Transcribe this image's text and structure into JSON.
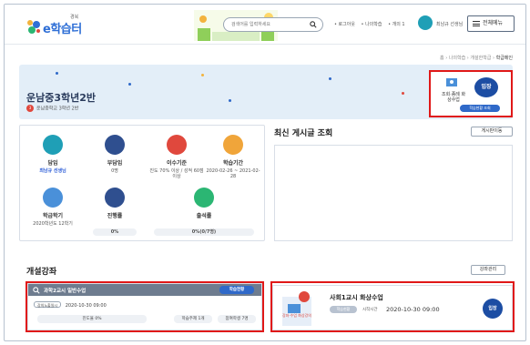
{
  "header": {
    "logo_sup": "경북",
    "logo_text": "e학습터",
    "search_placeholder": "검색어를 입력하세요",
    "top_links": [
      "• 로그아웃",
      "• 나의학습 ",
      "• 개의 1",
      "• 내정보 ",
      "• 개수 "
    ],
    "user_label": "최남규 선생님",
    "all_menu_label": "전체메뉴"
  },
  "breadcrumb": {
    "items": [
      "홈",
      "나의학습",
      "개설한학급"
    ],
    "current": "학급메인"
  },
  "class_banner": {
    "title": "운남중3학년2반",
    "badge": "3",
    "subtitle": "운남중학교 3학년 2반",
    "attendance_text": "조회·종례 화상수업",
    "attendance_button": "입장",
    "attendance_pill": "학습현황 조회"
  },
  "stats": [
    {
      "label": "담임",
      "value": "최남규 선생님",
      "icon": "teacher-icon",
      "color": "#1f9fb6"
    },
    {
      "label": "부담임",
      "value": "0명",
      "icon": "assistant-icon",
      "color": "#2f4f8f"
    },
    {
      "label": "이수기준",
      "value": "진도 70% 이상 / 성적 60점 이상",
      "icon": "check-icon",
      "color": "#e0483d"
    },
    {
      "label": "학습기간",
      "value": "2020-02-26 ~ 2021-02-28",
      "icon": "calendar-icon",
      "color": "#f0a53a"
    },
    {
      "label": "학급학기",
      "value": "2020학년도 12학기",
      "icon": "semester-icon",
      "color": "#4a90d9"
    },
    {
      "label": "진행률",
      "value": "0%",
      "icon": "percent-icon",
      "color": "#2f4f8f"
    },
    {
      "label": "출석률",
      "value": "0%(0/7명)",
      "icon": "attendance-icon",
      "color": "#2bb673"
    }
  ],
  "posts": {
    "title": "최신 게시글 조회",
    "manage_button": "게시판이동"
  },
  "courses": {
    "title": "개설강좌",
    "manage_button": "강좌관리",
    "course1": {
      "name": "과학2교시 일반수업",
      "status_button": "학습현황",
      "tag": "강의노출일시",
      "datetime": "2020-10-30 09:00",
      "progress": "진도율 0%",
      "task": "학습주제 1개",
      "learners": "참여학생 7명"
    },
    "course2": {
      "illu_text": "강좌·수업 화상강의",
      "name": "사회1교시 화상수업",
      "tag": "학습현황",
      "time_label": "시작시간",
      "datetime": "2020-10-30 09:00",
      "enter_button": "입장"
    }
  }
}
